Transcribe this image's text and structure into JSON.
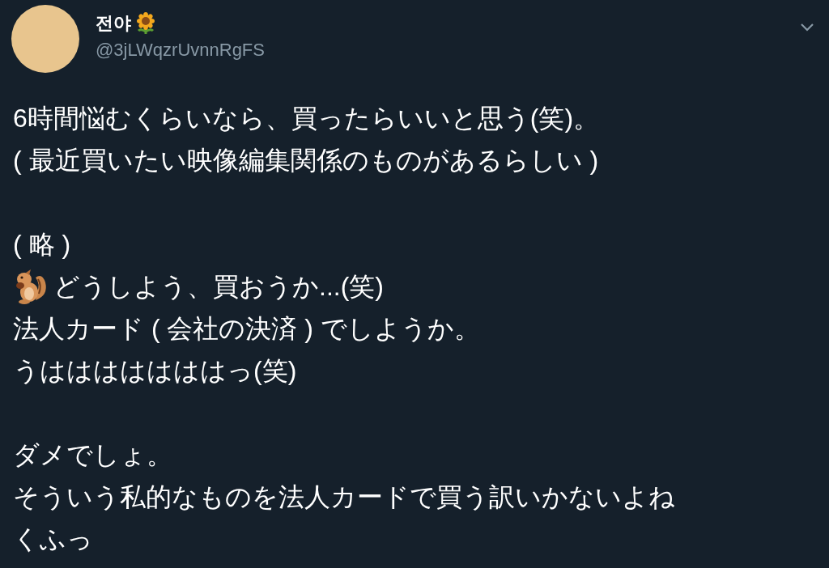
{
  "author": {
    "name": "전야",
    "handle": "@3jLWqzrUvnnRgFS"
  },
  "paragraphs": [
    [
      {
        "kind": "text",
        "text": "6時間悩むくらいなら、買ったらいいと思う(笑)。"
      },
      {
        "kind": "text",
        "text": "( 最近買いたい映像編集関係のものがあるらしい )"
      }
    ],
    [
      {
        "kind": "text",
        "text": "( 略 )"
      },
      {
        "kind": "icon_text",
        "text": "どうしよう、買おうか...(笑)"
      },
      {
        "kind": "text",
        "text": "法人カード ( 会社の決済 ) でしようか。"
      },
      {
        "kind": "text",
        "text": "うはははははははっ(笑)"
      }
    ],
    [
      {
        "kind": "text",
        "text": "ダメでしょ。"
      },
      {
        "kind": "text",
        "text": "そういう私的なものを法人カードで買う訳いかないよね"
      },
      {
        "kind": "text",
        "text": "くふっ"
      }
    ]
  ]
}
